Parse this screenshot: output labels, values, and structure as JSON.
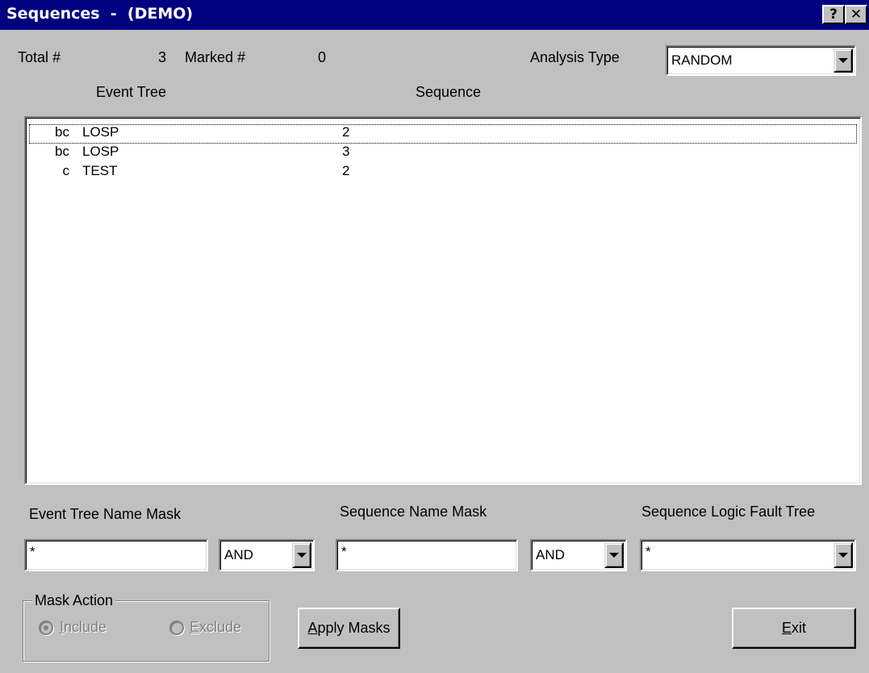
{
  "window": {
    "title": "Sequences  -  (DEMO)",
    "help_button": "?",
    "close_button": "✕"
  },
  "summary": {
    "total_label": "Total #",
    "total_value": "3",
    "marked_label": "Marked #",
    "marked_value": "0",
    "analysis_type_label": "Analysis Type",
    "analysis_type_value": "RANDOM"
  },
  "list": {
    "col_event_tree": "Event Tree",
    "col_sequence": "Sequence",
    "rows": [
      {
        "flag": "bc",
        "event_tree": "LOSP",
        "sequence": "2"
      },
      {
        "flag": "bc",
        "event_tree": "LOSP",
        "sequence": "3"
      },
      {
        "flag": "c",
        "event_tree": "TEST",
        "sequence": "2"
      }
    ]
  },
  "masks": {
    "event_tree_label": "Event Tree Name Mask",
    "event_tree_value": "*",
    "op1_value": "AND",
    "sequence_label": "Sequence Name Mask",
    "sequence_value": "*",
    "op2_value": "AND",
    "logic_ft_label": "Sequence Logic Fault Tree",
    "logic_ft_value": "*"
  },
  "mask_action": {
    "group_label": "Mask Action",
    "include_first": "I",
    "include_rest": "nclude",
    "exclude_first": "E",
    "exclude_rest": "xclude",
    "selected": "Include"
  },
  "buttons": {
    "apply_first": "A",
    "apply_rest": "pply Masks",
    "exit_first": "E",
    "exit_rest": "xit"
  }
}
